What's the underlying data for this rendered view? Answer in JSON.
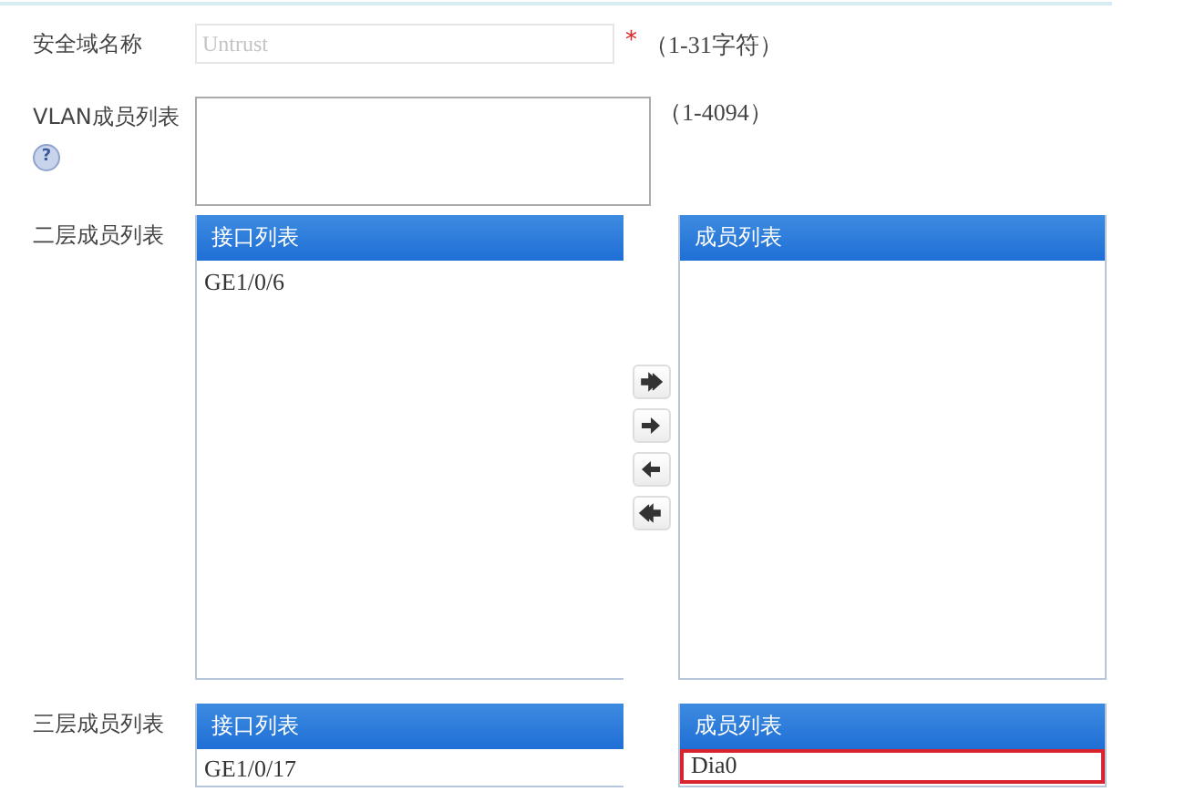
{
  "fields": [
    {
      "kind": "text",
      "label": "安全域名称",
      "placeholder": "Untrust",
      "required_mark": "*",
      "hint": "（1-31字符）"
    },
    {
      "kind": "textarea",
      "label": "VLAN成员列表",
      "help": "?",
      "hint": "（1-4094）"
    }
  ],
  "transfers": [
    {
      "label": "二层成员列表",
      "available": {
        "title": "接口列表",
        "items": [
          {
            "text": "GE1/0/6",
            "highlighted": false
          }
        ]
      },
      "members": {
        "title": "成员列表"
      },
      "move_buttons": [
        {
          "kind": "add_all"
        },
        {
          "kind": "add"
        },
        {
          "kind": "remove"
        },
        {
          "kind": "remove_all"
        }
      ]
    },
    {
      "label": "三层成员列表",
      "available": {
        "title": "接口列表",
        "items": [
          {
            "text": "GE1/0/17",
            "highlighted": false
          }
        ]
      },
      "members": {
        "title": "成员列表",
        "items": [
          {
            "text": "Dia0",
            "highlighted": true
          }
        ]
      }
    }
  ]
}
